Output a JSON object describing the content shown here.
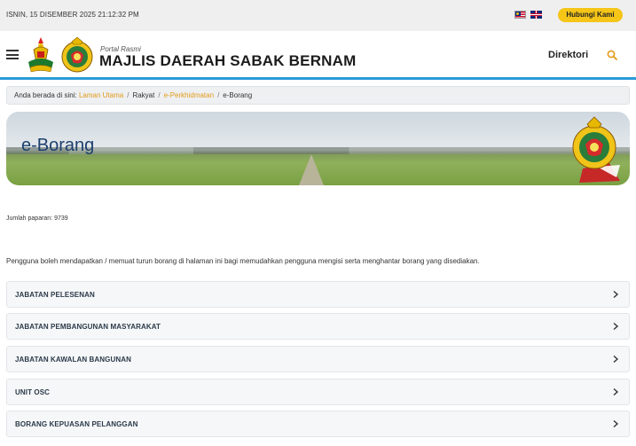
{
  "topbar": {
    "datetime": "ISNIN, 15 DISEMBER 2025 21:12:32 PM",
    "contact_label": "Hubungi Kami",
    "flags": [
      "malaysia-flag-icon",
      "uk-flag-icon"
    ]
  },
  "header": {
    "portal_label": "Portal Rasmi",
    "site_title": "MAJLIS DAERAH SABAK BERNAM",
    "nav_directory": "Direktori"
  },
  "breadcrumb": {
    "prefix": "Anda berada di sini:",
    "items": [
      "Laman Utama",
      "Rakyat",
      "e-Perkhidmatan",
      "e-Borang"
    ]
  },
  "banner": {
    "title": "e-Borang"
  },
  "page": {
    "view_count": "Jumlah paparan: 9739",
    "intro": "Pengguna boleh mendapatkan / memuat turun borang di halaman ini bagi memudahkan pengguna mengisi serta menghantar borang yang disediakan."
  },
  "accordion": [
    "JABATAN PELESENAN",
    "JABATAN PEMBANGUNAN MASYARAKAT",
    "JABATAN KAWALAN BANGUNAN",
    "UNIT OSC",
    "BORANG KEPUASAN PELANGGAN"
  ],
  "colors": {
    "accent_yellow": "#f5c518",
    "link_orange": "#e39b1a",
    "header_rule_blue": "#2a9bd7",
    "banner_title": "#1d3f6e"
  }
}
